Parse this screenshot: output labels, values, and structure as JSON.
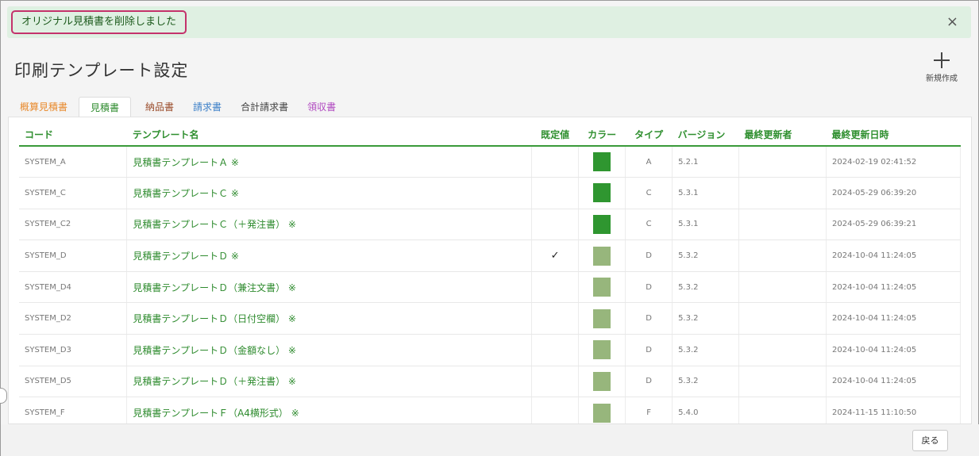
{
  "notice": {
    "message": "オリジナル見積書を削除しました",
    "close_glyph": "×"
  },
  "page": {
    "title": "印刷テンプレート設定",
    "new_label": "新規作成"
  },
  "tabs": [
    {
      "label": "概算見積書",
      "color": "#e8892b",
      "active": false
    },
    {
      "label": "見積書",
      "color": "#2e8b2e",
      "active": true
    },
    {
      "label": "納品書",
      "color": "#9a4b2a",
      "active": false
    },
    {
      "label": "請求書",
      "color": "#3b7fc8",
      "active": false
    },
    {
      "label": "合計請求書",
      "color": "#444444",
      "active": false
    },
    {
      "label": "領収書",
      "color": "#b048c0",
      "active": false
    }
  ],
  "table": {
    "headers": {
      "code": "コード",
      "name": "テンプレート名",
      "default": "既定値",
      "color": "カラー",
      "type": "タイプ",
      "version": "バージョン",
      "updater": "最終更新者",
      "updated": "最終更新日時"
    },
    "rows": [
      {
        "code": "SYSTEM_A",
        "name": "見積書テンプレートＡ ※",
        "default": "",
        "color": "#2f9630",
        "type": "A",
        "version": "5.2.1",
        "updater": "",
        "updated": "2024-02-19 02:41:52"
      },
      {
        "code": "SYSTEM_C",
        "name": "見積書テンプレートＣ ※",
        "default": "",
        "color": "#2f9630",
        "type": "C",
        "version": "5.3.1",
        "updater": "",
        "updated": "2024-05-29 06:39:20"
      },
      {
        "code": "SYSTEM_C2",
        "name": "見積書テンプレートＣ（＋発注書） ※",
        "default": "",
        "color": "#2f9630",
        "type": "C",
        "version": "5.3.1",
        "updater": "",
        "updated": "2024-05-29 06:39:21"
      },
      {
        "code": "SYSTEM_D",
        "name": "見積書テンプレートＤ ※",
        "default": "✓",
        "color": "#97b67c",
        "type": "D",
        "version": "5.3.2",
        "updater": "",
        "updated": "2024-10-04 11:24:05"
      },
      {
        "code": "SYSTEM_D4",
        "name": "見積書テンプレートＤ（兼注文書） ※",
        "default": "",
        "color": "#97b67c",
        "type": "D",
        "version": "5.3.2",
        "updater": "",
        "updated": "2024-10-04 11:24:05"
      },
      {
        "code": "SYSTEM_D2",
        "name": "見積書テンプレートＤ（日付空欄） ※",
        "default": "",
        "color": "#97b67c",
        "type": "D",
        "version": "5.3.2",
        "updater": "",
        "updated": "2024-10-04 11:24:05"
      },
      {
        "code": "SYSTEM_D3",
        "name": "見積書テンプレートＤ（金額なし） ※",
        "default": "",
        "color": "#97b67c",
        "type": "D",
        "version": "5.3.2",
        "updater": "",
        "updated": "2024-10-04 11:24:05"
      },
      {
        "code": "SYSTEM_D5",
        "name": "見積書テンプレートＤ（＋発注書） ※",
        "default": "",
        "color": "#97b67c",
        "type": "D",
        "version": "5.3.2",
        "updater": "",
        "updated": "2024-10-04 11:24:05"
      },
      {
        "code": "SYSTEM_F",
        "name": "見積書テンプレートＦ（A4横形式） ※",
        "default": "",
        "color": "#97b67c",
        "type": "F",
        "version": "5.4.0",
        "updater": "",
        "updated": "2024-11-15 11:10:50"
      }
    ]
  },
  "footer": {
    "back_label": "戻る"
  }
}
